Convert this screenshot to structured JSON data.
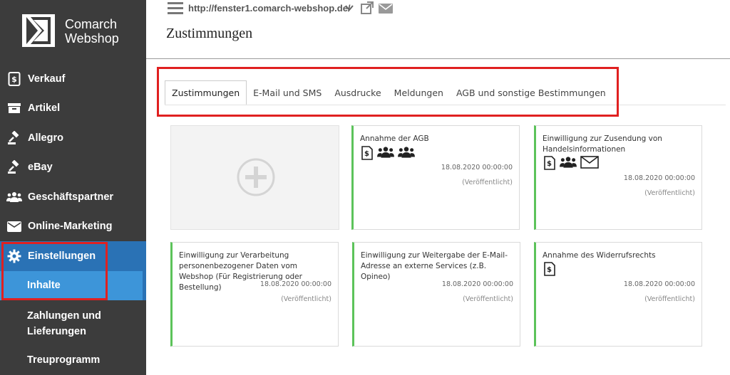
{
  "brand": {
    "line1": "Comarch",
    "line2": "Webshop"
  },
  "header": {
    "url": "http://fenster1.comarch-webshop.de/",
    "title": "Zustimmungen"
  },
  "sidebar": {
    "items": [
      {
        "label": "Verkauf",
        "icon": "invoice-icon"
      },
      {
        "label": "Artikel",
        "icon": "box-icon"
      },
      {
        "label": "Allegro",
        "icon": "gavel-icon"
      },
      {
        "label": "eBay",
        "icon": "gavel-icon"
      },
      {
        "label": "Geschäftspartner",
        "icon": "users-icon"
      },
      {
        "label": "Online-Marketing",
        "icon": "envelope-icon"
      },
      {
        "label": "Einstellungen",
        "icon": "gear-icon"
      }
    ],
    "sub": {
      "active": "Inhalte",
      "zahlungen": "Zahlungen und Lieferungen",
      "treu": "Treuprogramm"
    }
  },
  "tabs": [
    "Zustimmungen",
    "E-Mail und SMS",
    "Ausdrucke",
    "Meldungen",
    "AGB und sonstige Bestimmungen"
  ],
  "cards": [
    {
      "title": "Annahme der AGB",
      "date": "18.08.2020 00:00:00",
      "status": "(Veröffentlicht)",
      "icons": [
        "document-icon",
        "users-icon",
        "users-icon"
      ]
    },
    {
      "title": "Einwilligung zur Zusendung von Handelsinformationen",
      "date": "18.08.2020 00:00:00",
      "status": "(Veröffentlicht)",
      "icons": [
        "document-icon",
        "users-icon",
        "envelope-icon"
      ]
    },
    {
      "title": "Einwilligung zur Verarbeitung personenbezogener Daten vom Webshop (Für Registrierung oder Bestellung)",
      "date": "18.08.2020 00:00:00",
      "status": "(Veröffentlicht)",
      "icons": []
    },
    {
      "title": "Einwilligung zur Weitergabe der E-Mail-Adresse an externe Services (z.B. Opineo)",
      "date": "18.08.2020 00:00:00",
      "status": "(Veröffentlicht)",
      "icons": []
    },
    {
      "title": "Annahme des Widerrufsrechts",
      "date": "18.08.2020 00:00:00",
      "status": "(Veröffentlicht)",
      "icons": [
        "document-icon"
      ]
    }
  ],
  "colors": {
    "sidebar": "#3c3c3c",
    "active": "#2a72b5",
    "sub_active": "#3d95d9",
    "published": "#5cc35a",
    "highlight": "#e02020"
  }
}
